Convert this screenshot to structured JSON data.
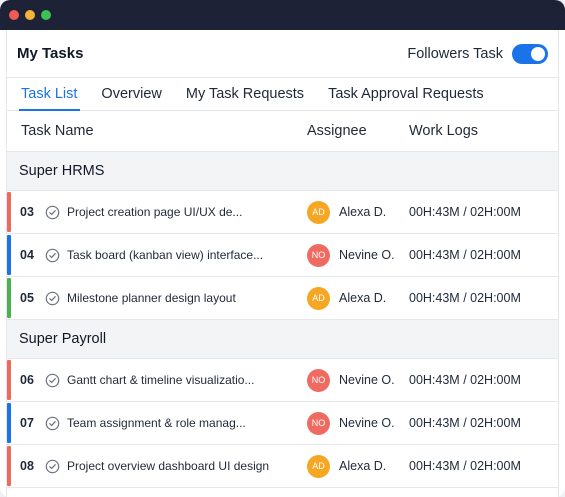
{
  "header": {
    "title": "My Tasks",
    "followers_label": "Followers Task",
    "followers_on": true
  },
  "tabs": [
    {
      "label": "Task List",
      "active": true
    },
    {
      "label": "Overview",
      "active": false
    },
    {
      "label": "My Task Requests",
      "active": false
    },
    {
      "label": "Task Approval Requests",
      "active": false
    }
  ],
  "columns": {
    "name": "Task Name",
    "assignee": "Assignee",
    "logs": "Work Logs"
  },
  "groups": [
    {
      "name": "Super HRMS",
      "rows": [
        {
          "num": "03",
          "task": "Project creation page UI/UX de...",
          "initials": "AD",
          "assignee": "Alexa D.",
          "logs": "00H:43M / 02H:00M",
          "bar_color": "#ee6a5f",
          "avatar_color": "#f5a623"
        },
        {
          "num": "04",
          "task": "Task board (kanban view) interface...",
          "initials": "NO",
          "assignee": "Nevine O.",
          "logs": "00H:43M / 02H:00M",
          "bar_color": "#1a73e8",
          "avatar_color": "#ef6b61"
        },
        {
          "num": "05",
          "task": "Milestone planner design layout",
          "initials": "AD",
          "assignee": "Alexa D.",
          "logs": "00H:43M / 02H:00M",
          "bar_color": "#4caf50",
          "avatar_color": "#f5a623"
        }
      ]
    },
    {
      "name": "Super Payroll",
      "rows": [
        {
          "num": "06",
          "task": "Gantt chart & timeline visualizatio...",
          "initials": "NO",
          "assignee": "Nevine O.",
          "logs": "00H:43M / 02H:00M",
          "bar_color": "#ee6a5f",
          "avatar_color": "#ef6b61"
        },
        {
          "num": "07",
          "task": "Team assignment & role manag...",
          "initials": "NO",
          "assignee": "Nevine O.",
          "logs": "00H:43M / 02H:00M",
          "bar_color": "#1a73e8",
          "avatar_color": "#ef6b61"
        },
        {
          "num": "08",
          "task": "Project overview dashboard UI design",
          "initials": "AD",
          "assignee": "Alexa D.",
          "logs": "00H:43M / 02H:00M",
          "bar_color": "#ee6a5f",
          "avatar_color": "#f5a623"
        }
      ]
    }
  ]
}
